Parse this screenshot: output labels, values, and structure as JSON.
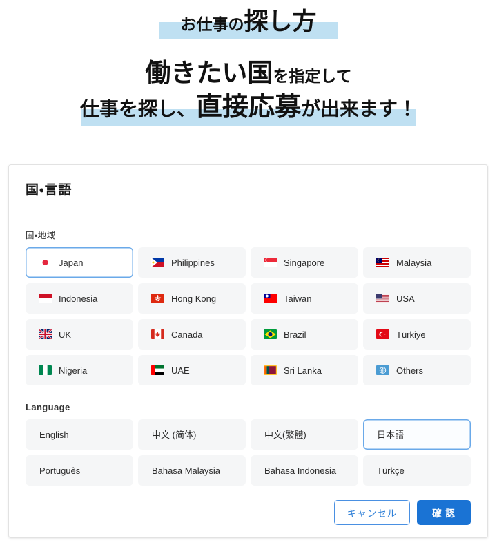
{
  "hero": {
    "line1_small": "お仕事の",
    "line1_big": "探し方",
    "line2_big": "働きたい国",
    "line2_small": "を指定して",
    "line3_pre": "仕事を探し、",
    "line3_big": "直接応募",
    "line3_post": "が出来ます！",
    "highlight_color": "#bfe0f2"
  },
  "dialog": {
    "title": "国・言語",
    "country_section_label": "国・地域",
    "language_section_label": "Language",
    "accent_color": "#1a73d4",
    "selected_border_color": "#6aa9e9",
    "option_background": "#f5f6f7",
    "countries": [
      {
        "label": "Japan",
        "flag": "flag-japan",
        "selected": true
      },
      {
        "label": "Philippines",
        "flag": "flag-philippines",
        "selected": false
      },
      {
        "label": "Singapore",
        "flag": "flag-singapore",
        "selected": false
      },
      {
        "label": "Malaysia",
        "flag": "flag-malaysia",
        "selected": false
      },
      {
        "label": "Indonesia",
        "flag": "flag-indonesia",
        "selected": false
      },
      {
        "label": "Hong Kong",
        "flag": "flag-hong-kong",
        "selected": false
      },
      {
        "label": "Taiwan",
        "flag": "flag-taiwan",
        "selected": false
      },
      {
        "label": "USA",
        "flag": "flag-usa",
        "selected": false
      },
      {
        "label": "UK",
        "flag": "flag-uk",
        "selected": false
      },
      {
        "label": "Canada",
        "flag": "flag-canada",
        "selected": false
      },
      {
        "label": "Brazil",
        "flag": "flag-brazil",
        "selected": false
      },
      {
        "label": "Türkiye",
        "flag": "flag-turkiye",
        "selected": false
      },
      {
        "label": "Nigeria",
        "flag": "flag-nigeria",
        "selected": false
      },
      {
        "label": "UAE",
        "flag": "flag-uae",
        "selected": false
      },
      {
        "label": "Sri Lanka",
        "flag": "flag-sri-lanka",
        "selected": false
      },
      {
        "label": "Others",
        "flag": "flag-united-nations",
        "selected": false
      }
    ],
    "languages": [
      {
        "label": "English",
        "selected": false
      },
      {
        "label": "中文 (简体)",
        "selected": false
      },
      {
        "label": "中文(繁體)",
        "selected": false
      },
      {
        "label": "日本語",
        "selected": true
      },
      {
        "label": "Português",
        "selected": false
      },
      {
        "label": "Bahasa Malaysia",
        "selected": false
      },
      {
        "label": "Bahasa Indonesia",
        "selected": false
      },
      {
        "label": "Türkçe",
        "selected": false
      }
    ],
    "cancel_label": "キャンセル",
    "confirm_label": "確 認"
  }
}
